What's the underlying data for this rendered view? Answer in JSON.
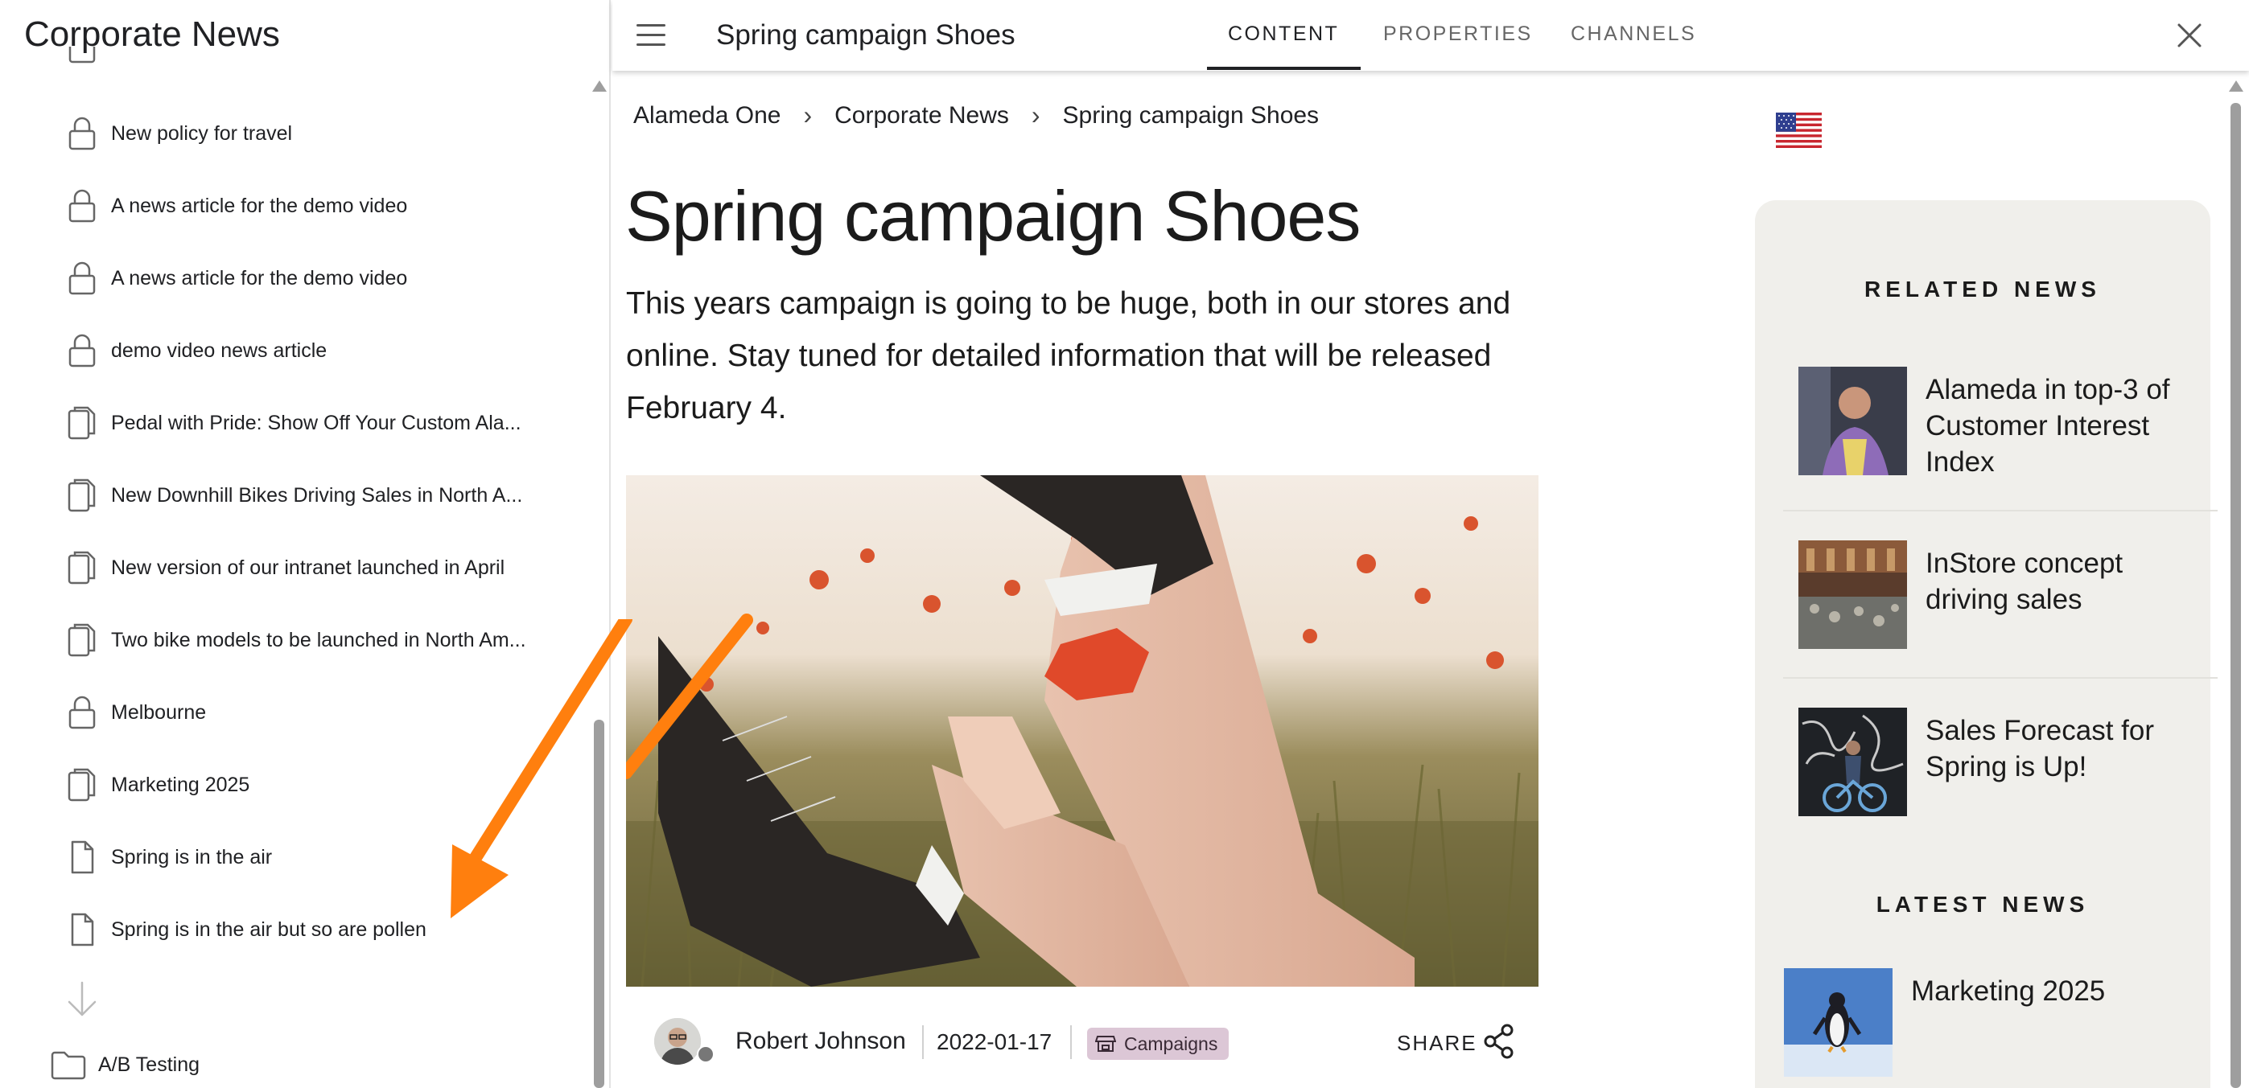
{
  "left_panel": {
    "title": "Corporate News",
    "items": [
      {
        "label": "New policy for travel",
        "icon": "lock-icon"
      },
      {
        "label": "A news article for the demo video",
        "icon": "lock-icon"
      },
      {
        "label": "A news article for the demo video",
        "icon": "lock-icon"
      },
      {
        "label": "demo video news article",
        "icon": "lock-icon"
      },
      {
        "label": "Pedal with Pride: Show Off Your Custom Ala...",
        "icon": "pages-icon"
      },
      {
        "label": "New Downhill Bikes Driving Sales in North A...",
        "icon": "pages-icon"
      },
      {
        "label": "New version of our intranet launched in April",
        "icon": "pages-icon"
      },
      {
        "label": "Two bike models to be launched in North Am...",
        "icon": "pages-icon"
      },
      {
        "label": "Melbourne",
        "icon": "lock-icon"
      },
      {
        "label": "Marketing 2025",
        "icon": "pages-icon"
      },
      {
        "label": "Spring is in the air",
        "icon": "page-icon"
      },
      {
        "label": "Spring is in the air but so are pollen",
        "icon": "page-icon"
      }
    ],
    "folder": {
      "label": "A/B Testing",
      "icon": "folder-icon"
    }
  },
  "header": {
    "title": "Spring campaign Shoes",
    "tabs": [
      {
        "label": "CONTENT",
        "active": true
      },
      {
        "label": "PROPERTIES",
        "active": false
      },
      {
        "label": "CHANNELS",
        "active": false
      }
    ]
  },
  "breadcrumb": [
    "Alameda One",
    "Corporate News",
    "Spring campaign Shoes"
  ],
  "article": {
    "title": "Spring campaign Shoes",
    "lead": "This years campaign is going to be huge, both in our stores and online. Stay tuned for detailed information that will be released February 4.",
    "author": "Robert Johnson",
    "date": "2022-01-17",
    "category": "Campaigns",
    "share_label": "SHARE"
  },
  "sidebar": {
    "related_heading": "RELATED NEWS",
    "related": [
      {
        "title": "Alameda in top-3 of Customer Interest Index"
      },
      {
        "title": "InStore concept driving sales"
      },
      {
        "title": "Sales Forecast for Spring is Up!"
      }
    ],
    "latest_heading": "LATEST NEWS",
    "latest": [
      {
        "title": "Marketing 2025"
      }
    ]
  },
  "colors": {
    "annotation_arrow": "#ff7f0e",
    "category_chip": "#dcc7d6",
    "sidebar_bg": "#f0efeb",
    "scrollbar": "#9e9e9e"
  }
}
